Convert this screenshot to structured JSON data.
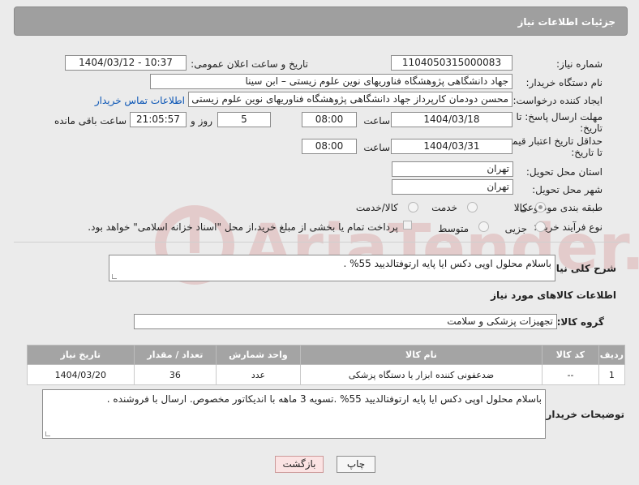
{
  "header": {
    "title": "جزئیات اطلاعات نیاز"
  },
  "fields": {
    "need_number_label": "شماره نیاز:",
    "need_number": "1104050315000083",
    "announce_label": "تاریخ و ساعت اعلان عمومی:",
    "announce_value": "1404/03/12 - 10:37",
    "buyer_org_label": "نام دستگاه خریدار:",
    "buyer_org": "جهاد دانشگاهی پژوهشگاه فناوریهای نوین علوم زیستی – ابن سینا",
    "creator_label": "ایجاد کننده درخواست:",
    "creator": "محسن دودمان کارپرداز جهاد دانشگاهی پژوهشگاه فناوریهای نوین علوم زیستی",
    "contact_link": "اطلاعات تماس خریدار",
    "deadline_label_1": "مهلت ارسال پاسخ: تا",
    "deadline_label_2": "تاریخ:",
    "deadline_date": "1404/03/18",
    "time_label": "ساعت",
    "deadline_time": "08:00",
    "days_value": "5",
    "days_label": "روز و",
    "remaining_time": "21:05:57",
    "remaining_label": "ساعت باقی مانده",
    "price_label_1": "حداقل تاریخ اعتبار قیمت:",
    "price_label_2": "تا تاریخ:",
    "price_date": "1404/03/31",
    "price_time": "08:00",
    "province_label": "استان محل تحویل:",
    "province": "تهران",
    "city_label": "شهر محل تحویل:",
    "city": "تهران",
    "category_label": "طبقه بندی موضوعی:",
    "category_options": [
      "کالا",
      "خدمت",
      "کالا/خدمت"
    ],
    "category_selected": "کالا",
    "process_label": "نوع فرآیند خرید :",
    "process_options": [
      "جزیی",
      "متوسط"
    ],
    "process_note": "پرداخت تمام یا بخشی از مبلغ خرید،از محل \"اسناد خزانه اسلامی\" خواهد بود."
  },
  "description": {
    "label": "شرح کلی نیاز:",
    "value": "باسلام محلول اوپی دکس ایا پایه ارتوفتالدیید 55% ."
  },
  "goods_section": {
    "title": "اطلاعات کالاهای مورد نیاز",
    "group_label": "گروه کالا:",
    "group_value": "تجهیزات پزشکی و سلامت"
  },
  "table": {
    "headers": [
      "ردیف",
      "کد کالا",
      "نام کالا",
      "واحد شمارش",
      "تعداد / مقدار",
      "تاریخ نیاز"
    ],
    "rows": [
      [
        "1",
        "--",
        "ضدعفونی کننده ابزار یا دستگاه پزشکی",
        "عدد",
        "36",
        "1404/03/20"
      ]
    ]
  },
  "buyer_notes": {
    "label": "توضیحات خریدار:",
    "value": "باسلام محلول اوپی دکس ایا پایه ارتوفتالدیید 55% .تسویه 3 ماهه با اندیکاتور مخصوص. ارسال با فروشنده ."
  },
  "buttons": {
    "print": "چاپ",
    "back": "بازگشت"
  },
  "watermark": "AriaTender.net"
}
